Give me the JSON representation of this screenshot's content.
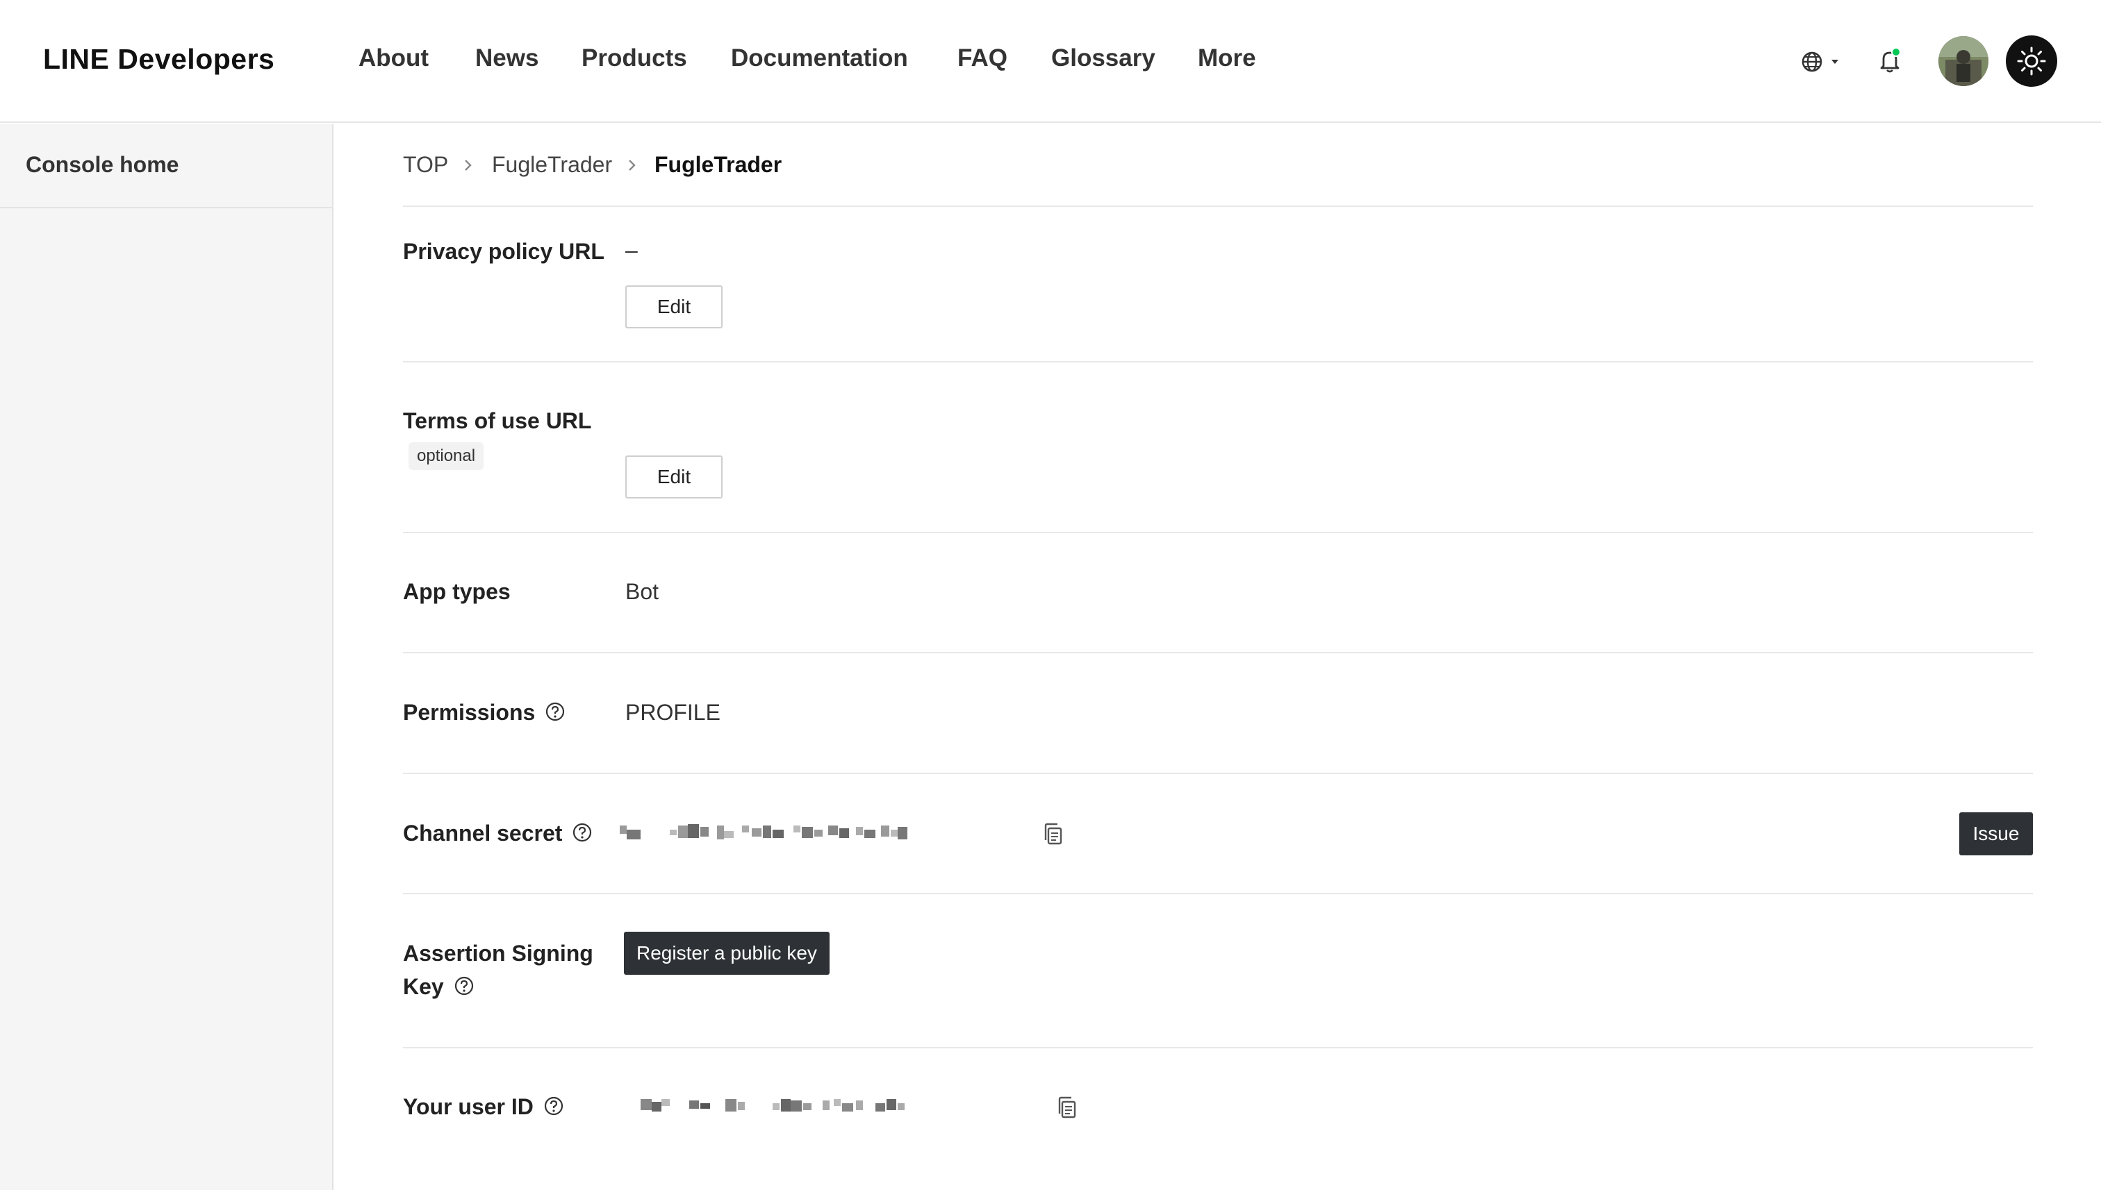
{
  "header": {
    "logo": "LINE Developers",
    "nav": [
      "About",
      "News",
      "Products",
      "Documentation",
      "FAQ",
      "Glossary",
      "More"
    ]
  },
  "sidebar": {
    "items": [
      {
        "label": "Console home"
      }
    ]
  },
  "breadcrumb": [
    "TOP",
    "FugleTrader",
    "FugleTrader"
  ],
  "settings": {
    "privacy_policy": {
      "label": "Privacy policy URL",
      "value": "–",
      "edit_label": "Edit"
    },
    "terms_of_use": {
      "label": "Terms of use URL",
      "badge": "optional",
      "edit_label": "Edit"
    },
    "app_types": {
      "label": "App types",
      "value": "Bot"
    },
    "permissions": {
      "label": "Permissions",
      "value": "PROFILE"
    },
    "channel_secret": {
      "label": "Channel secret",
      "issue_label": "Issue"
    },
    "assertion_key": {
      "label_line1": "Assertion Signing",
      "label_line2": "Key",
      "button_label": "Register a public key"
    },
    "user_id": {
      "label": "Your user ID"
    }
  },
  "colors": {
    "accent": "#06c755",
    "dark_button": "#2e3236"
  }
}
